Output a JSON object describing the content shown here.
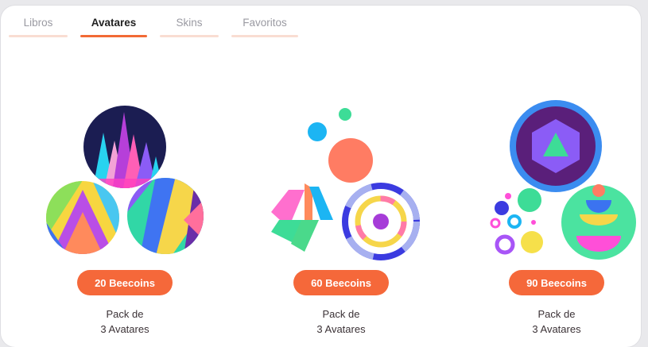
{
  "tabs": [
    {
      "label": "Libros",
      "active": false
    },
    {
      "label": "Avatares",
      "active": true
    },
    {
      "label": "Skins",
      "active": false
    },
    {
      "label": "Favoritos",
      "active": false
    }
  ],
  "packs": [
    {
      "price": "20 Beecoins",
      "line1": "Pack de",
      "line2": "3 Avatares"
    },
    {
      "price": "60 Beecoins",
      "line1": "Pack de",
      "line2": "3 Avatares"
    },
    {
      "price": "90 Beecoins",
      "line1": "Pack de",
      "line2": "3 Avatares"
    }
  ],
  "colors": {
    "accent": "#f26a35",
    "button": "#f5683a",
    "tab_inactive_bar": "#f9ddd2"
  }
}
